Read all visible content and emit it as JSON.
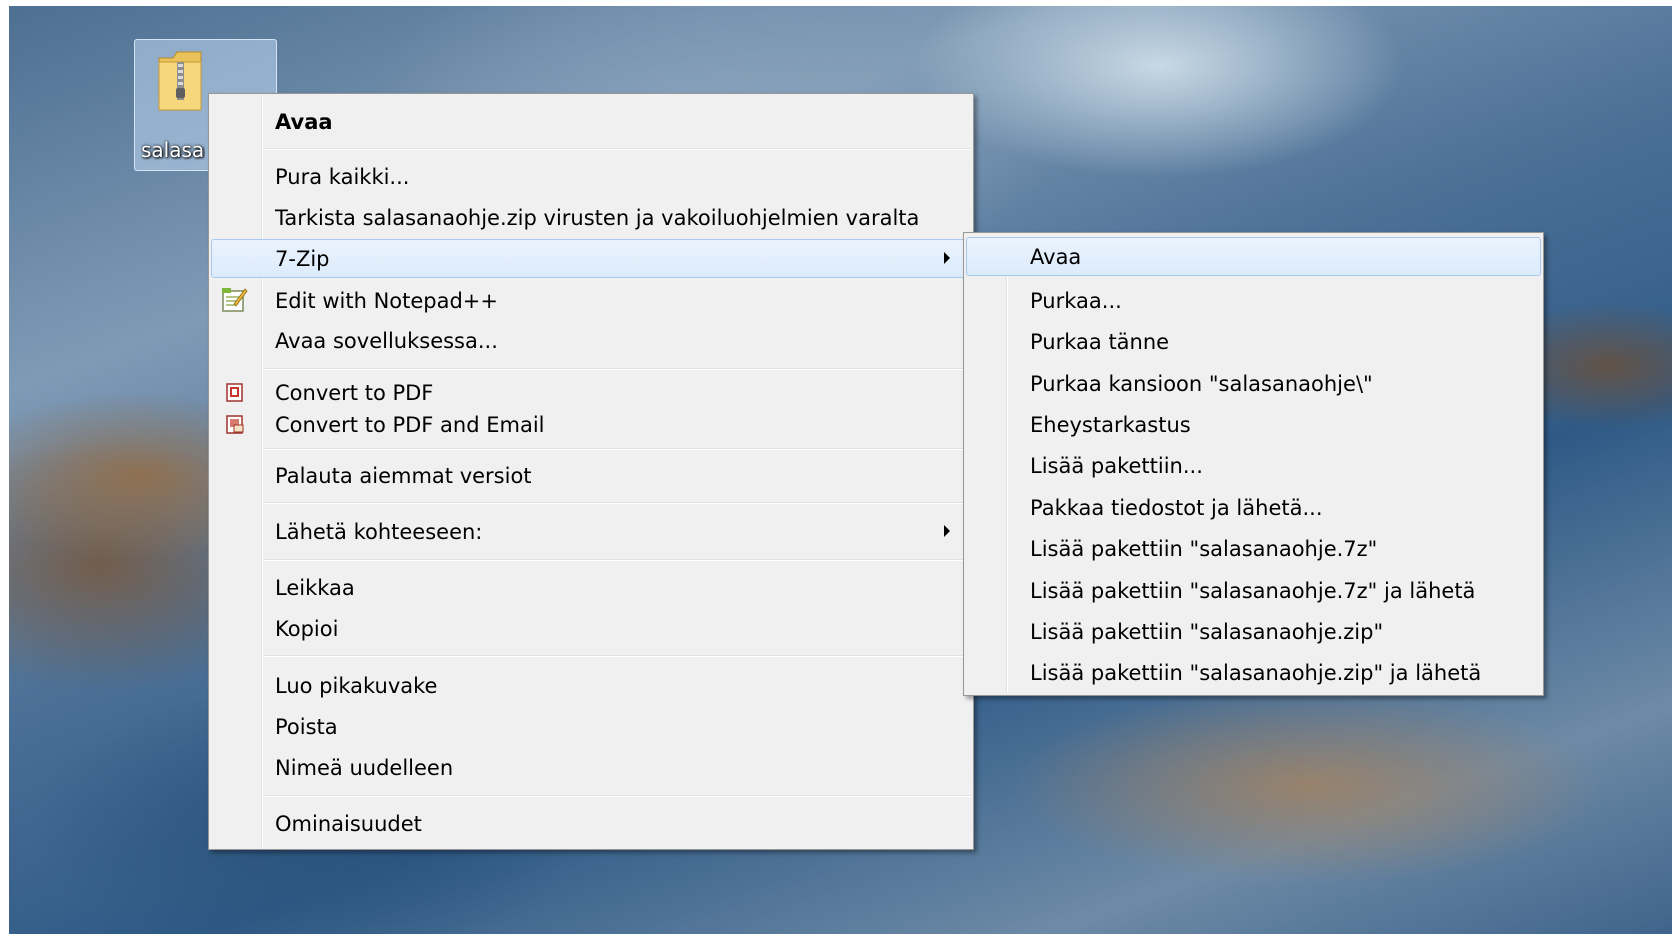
{
  "desktop": {
    "file_icon_label": "salasan",
    "file_icon": "zip-folder-icon"
  },
  "context_menu": {
    "items": [
      {
        "label": "Avaa",
        "bold": true
      },
      {
        "label": "Pura kaikki..."
      },
      {
        "label": "Tarkista salasanaohje.zip virusten ja vakoiluohjelmien varalta"
      },
      {
        "label": "7-Zip",
        "submenu": true,
        "highlighted": true
      },
      {
        "label": "Edit with Notepad++",
        "icon": "notepad-plus-plus-icon"
      },
      {
        "label": "Avaa sovelluksessa..."
      },
      {
        "label": "Convert to PDF",
        "icon": "pdf-icon"
      },
      {
        "label": "Convert to PDF and Email",
        "icon": "pdf-email-icon"
      },
      {
        "label": "Palauta aiemmat versiot"
      },
      {
        "label": "Lähetä kohteeseen:",
        "submenu": true
      },
      {
        "label": "Leikkaa"
      },
      {
        "label": "Kopioi"
      },
      {
        "label": "Luo pikakuvake"
      },
      {
        "label": "Poista"
      },
      {
        "label": "Nimeä uudelleen"
      },
      {
        "label": "Ominaisuudet"
      }
    ]
  },
  "submenu_7zip": {
    "items": [
      {
        "label": "Avaa",
        "highlighted": true
      },
      {
        "label": "Purkaa..."
      },
      {
        "label": "Purkaa tänne"
      },
      {
        "label": "Purkaa kansioon \"salasanaohje\\\""
      },
      {
        "label": "Eheystarkastus"
      },
      {
        "label": "Lisää pakettiin..."
      },
      {
        "label": "Pakkaa tiedostot ja lähetä..."
      },
      {
        "label": "Lisää pakettiin \"salasanaohje.7z\""
      },
      {
        "label": "Lisää pakettiin \"salasanaohje.7z\" ja lähetä"
      },
      {
        "label": "Lisää pakettiin \"salasanaohje.zip\""
      },
      {
        "label": "Lisää pakettiin \"salasanaohje.zip\" ja lähetä"
      }
    ]
  },
  "colors": {
    "menu_bg": "#f0f0f0",
    "highlight_bg": "#dcebfc",
    "highlight_border": "#a9c9ef"
  }
}
